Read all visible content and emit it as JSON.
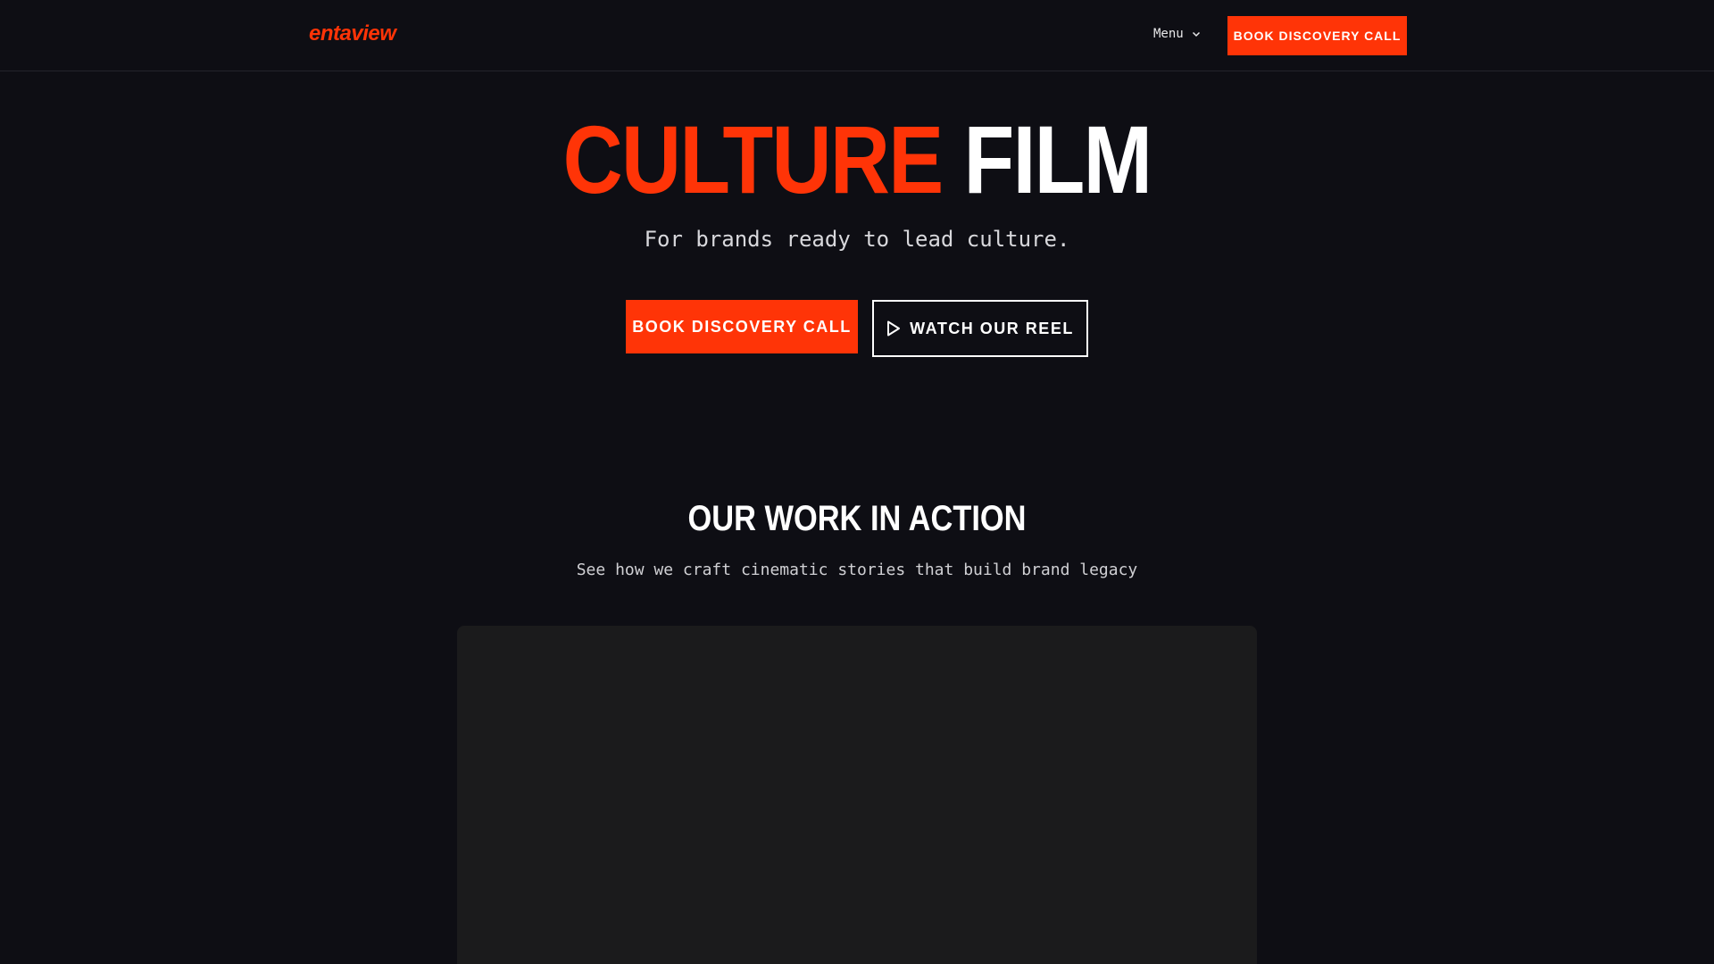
{
  "header": {
    "logo": "entaview",
    "menu_label": "Menu",
    "cta_label": "BOOK DISCOVERY CALL"
  },
  "hero": {
    "title_accent": "CULTURE",
    "title_plain": "FILM",
    "subtitle": "For brands ready to lead culture.",
    "primary_button": "BOOK DISCOVERY CALL",
    "secondary_button": "WATCH OUR REEL"
  },
  "work_section": {
    "title": "OUR WORK IN ACTION",
    "subtitle": "See how we craft cinematic stories that build brand legacy"
  },
  "icons": {
    "menu_chevron": "chevron-down-icon",
    "reel_play": "play-icon"
  },
  "colors": {
    "accent": "#ff3407",
    "background": "#0e0e14",
    "video_placeholder": "#1b1b1c"
  }
}
